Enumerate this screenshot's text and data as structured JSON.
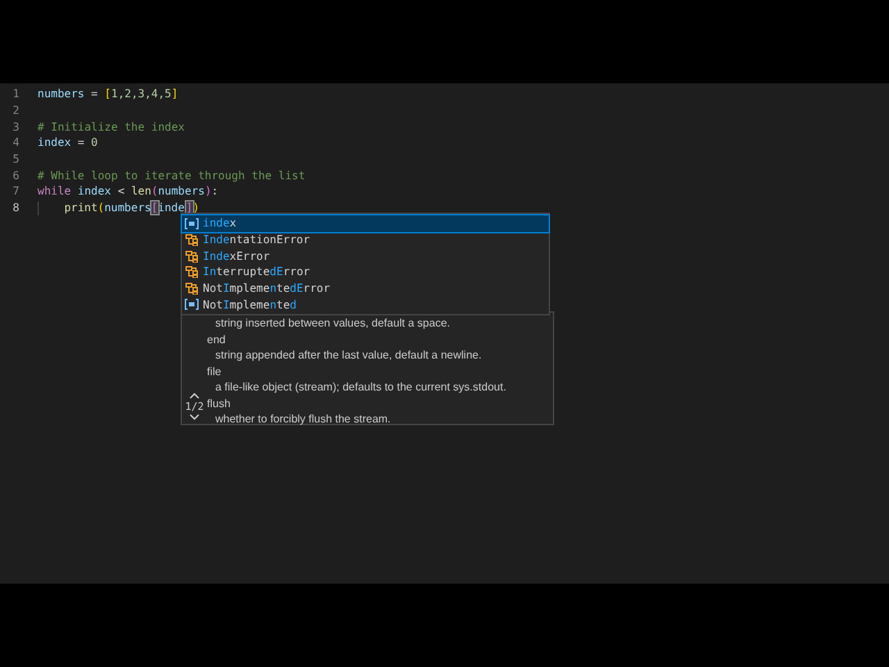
{
  "editor": {
    "lines": [
      {
        "number": "1",
        "active": false,
        "tokens": [
          {
            "kind": "var",
            "text": "numbers"
          },
          {
            "kind": "plain",
            "text": " = "
          },
          {
            "kind": "bracket",
            "text": "["
          },
          {
            "kind": "number",
            "text": "1,2,3,4,5"
          },
          {
            "kind": "bracket",
            "text": "]"
          }
        ]
      },
      {
        "number": "2",
        "active": false
      },
      {
        "number": "3",
        "active": false,
        "tokens": [
          {
            "kind": "comment",
            "text": "# Initialize the index"
          }
        ]
      },
      {
        "number": "4",
        "active": false,
        "tokens": [
          {
            "kind": "var",
            "text": "index"
          },
          {
            "kind": "plain",
            "text": " = "
          },
          {
            "kind": "number",
            "text": "0"
          }
        ]
      },
      {
        "number": "5",
        "active": false
      },
      {
        "number": "6",
        "active": false,
        "tokens": [
          {
            "kind": "comment",
            "text": "# While loop to iterate through the list"
          }
        ]
      },
      {
        "number": "7",
        "active": false,
        "tokens": [
          {
            "kind": "keyword",
            "text": "while"
          },
          {
            "kind": "var",
            "text": " index"
          },
          {
            "kind": "plain",
            "text": " < "
          },
          {
            "kind": "func",
            "text": "len"
          },
          {
            "kind": "bracket2",
            "text": "("
          },
          {
            "kind": "var",
            "text": "numbers"
          },
          {
            "kind": "bracket2",
            "text": ")"
          },
          {
            "kind": "plain",
            "text": ":"
          }
        ]
      },
      {
        "number": "8",
        "active": true,
        "tokens": [
          {
            "kind": "indent"
          },
          {
            "kind": "func",
            "text": "print"
          },
          {
            "kind": "bracket",
            "text": "("
          },
          {
            "kind": "var",
            "text": "numbers"
          },
          {
            "kind": "matched",
            "text": "["
          },
          {
            "kind": "var",
            "text": "inde"
          },
          {
            "kind": "cursor"
          },
          {
            "kind": "matched",
            "text": "]"
          },
          {
            "kind": "bracket",
            "text": ")"
          }
        ]
      }
    ]
  },
  "suggestions": [
    {
      "kind": "variable",
      "label": "**inde**x",
      "selected": true
    },
    {
      "kind": "class",
      "label": "**Inde**ntationError",
      "selected": false
    },
    {
      "kind": "class",
      "label": "**Inde**xError",
      "selected": false
    },
    {
      "kind": "class",
      "label": "**In**terrupte**dE**rror",
      "selected": false
    },
    {
      "kind": "class",
      "label": "Not**I**mpleme**n**te**dE**rror",
      "selected": false
    },
    {
      "kind": "variable",
      "label": "Not**I**mpleme**n**te**d**",
      "selected": false
    }
  ],
  "signature_help": {
    "page": "1/2",
    "lines": [
      {
        "kind": "desc",
        "text": "string inserted between values, default a space."
      },
      {
        "kind": "param",
        "text": "end"
      },
      {
        "kind": "desc",
        "text": "string appended after the last value, default a newline."
      },
      {
        "kind": "param",
        "text": "file"
      },
      {
        "kind": "desc",
        "text": "a file-like object (stream); defaults to the current sys.stdout."
      },
      {
        "kind": "param",
        "text": "flush"
      },
      {
        "kind": "desc",
        "text": "whether to forcibly flush the stream."
      }
    ]
  }
}
